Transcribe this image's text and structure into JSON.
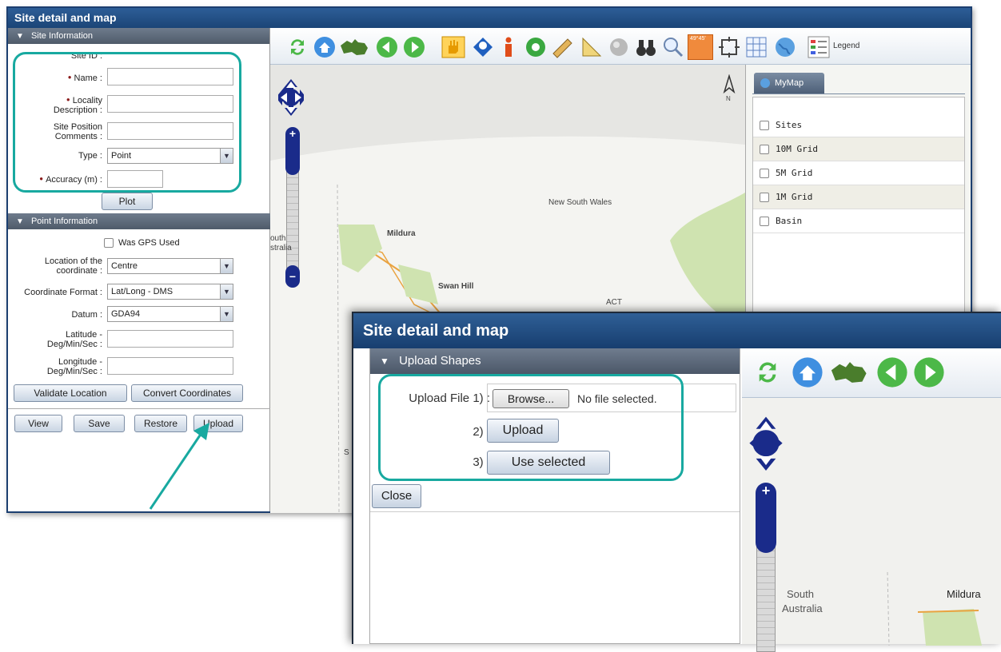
{
  "window": {
    "title": "Site detail and map"
  },
  "site_info": {
    "header": "Site Information",
    "site_id_label": "Site ID :",
    "name_label": "Name :",
    "locality_label": "Locality Description :",
    "site_position_label": "Site Position Comments :",
    "type_label": "Type :",
    "type_value": "Point",
    "accuracy_label": "Accuracy (m) :",
    "plot_button": "Plot"
  },
  "point_info": {
    "header": "Point Information",
    "gps_label": "Was GPS Used",
    "location_label": "Location of the coordinate :",
    "location_value": "Centre",
    "coord_format_label": "Coordinate Format :",
    "coord_format_value": "Lat/Long - DMS",
    "datum_label": "Datum :",
    "datum_value": "GDA94",
    "latitude_label": "Latitude - Deg/Min/Sec :",
    "longitude_label": "Longitude - Deg/Min/Sec :",
    "validate_button": "Validate Location",
    "convert_button": "Convert Coordinates"
  },
  "actions": {
    "view": "View",
    "save": "Save",
    "restore": "Restore",
    "upload": "Upload"
  },
  "toolbar": {
    "legend_label": "Legend",
    "scale_badge": "49°45'"
  },
  "map": {
    "north_label": "N",
    "labels": {
      "nsw": "New South Wales",
      "mildura": "Mildura",
      "swan_hill": "Swan Hill",
      "act": "ACT",
      "south_aus_1": "outh",
      "south_aus_2": "stralia",
      "s_frag": "S"
    }
  },
  "layers": {
    "tab": "MyMap",
    "items": [
      "Sites",
      "10M Grid",
      "5M Grid",
      "1M Grid",
      "Basin"
    ]
  },
  "upload_window": {
    "title": "Site detail and map",
    "section": "Upload Shapes",
    "step1_label": "Upload File 1) :",
    "browse_button": "Browse...",
    "no_file": "No file selected.",
    "step2_label": "2) :",
    "upload_button": "Upload",
    "step3_label": "3) :",
    "use_selected_button": "Use selected",
    "close_button": "Close",
    "map_labels": {
      "south": "South",
      "australia": "Australia",
      "mildura": "Mildura"
    }
  },
  "colors": {
    "highlight": "#18a9a0",
    "title_bar": "#1f4a7d",
    "required_dot": "#8a1a1a"
  }
}
